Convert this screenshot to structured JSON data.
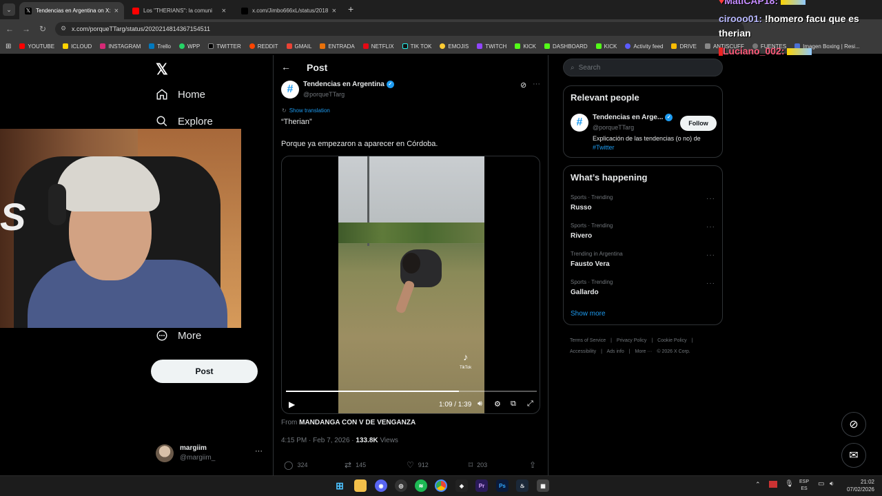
{
  "browser": {
    "tabs": [
      {
        "title": "Tendencias en Argentina on X:"
      },
      {
        "title": "Los \"THERIANS\": la comuni"
      },
      {
        "title": "x.com/Jimbo666xL/status/2018"
      }
    ],
    "new_tab": "+",
    "url": "x.com/porqueTTarg/status/2020214814367154511",
    "bookmarks": [
      "YOUTUBE",
      "ICLOUD",
      "INSTAGRAM",
      "Trello",
      "WPP",
      "TWITTER",
      "REDDIT",
      "GMAIL",
      "ENTRADA",
      "NETFLIX",
      "TIK TOK",
      "EMOJIS",
      "TWITCH",
      "KICK",
      "DASHBOARD",
      "KICK",
      "Activity feed",
      "DRIVE",
      "ANTISCUFF",
      "FUENTES",
      "Imagen Boxing | Resi..."
    ]
  },
  "chat": {
    "top_user": "MatiCAP18:",
    "line1_user": "cirooo01:",
    "line1_msg": "!homero facu que es therian",
    "line2_user": "Luciano_002:"
  },
  "nav": {
    "home": "Home",
    "explore": "Explore",
    "more": "More",
    "post_button": "Post",
    "account_name": "margiim",
    "account_handle": "@margiim_"
  },
  "post": {
    "header_title": "Post",
    "author_name": "Tendencias en Argentina",
    "author_handle": "@porqueTTarg",
    "show_translation": "Show translation",
    "line1": "“Therian”",
    "line2": "Porque ya empezaron a aparecer en Córdoba.",
    "video_time": "1:09 / 1:39",
    "video_progress": 0.69,
    "from_label": "From",
    "from_source": "MANDANGA CON V DE VENGANZA",
    "timestamp": "4:15 PM · Feb 7, 2026 ·",
    "views_count": "133.8K",
    "views_label": "Views",
    "replies": "324",
    "reposts": "145",
    "likes": "912",
    "bookmarks": "203",
    "tiktok_label": "TikTok"
  },
  "sidebar": {
    "search_placeholder": "Search",
    "relevant_title": "Relevant people",
    "person_name": "Tendencias en Arge...",
    "person_handle": "@porqueTTarg",
    "follow_button": "Follow",
    "person_bio": "Explicación de las tendencias (o no) de",
    "person_bio_link": "#Twitter",
    "happening_title": "What’s happening",
    "trends": [
      {
        "context": "Sports · Trending",
        "name": "Russo"
      },
      {
        "context": "Sports · Trending",
        "name": "Rivero"
      },
      {
        "context": "Trending in Argentina",
        "name": "Fausto Vera"
      },
      {
        "context": "Sports · Trending",
        "name": "Gallardo"
      }
    ],
    "show_more": "Show more",
    "footer": [
      "Terms of Service",
      "|",
      "Privacy Policy",
      "|",
      "Cookie Policy",
      "|",
      "Accessibility",
      "|",
      "Ads info",
      "|",
      "More ···",
      "© 2026 X Corp."
    ]
  },
  "taskbar": {
    "lang_top": "ESP",
    "lang_bottom": "ES",
    "time": "21:02",
    "date": "07/02/2026"
  },
  "colors": {
    "accent": "#1d9bf0",
    "verified": "#1d9bf0",
    "background": "#000000"
  }
}
